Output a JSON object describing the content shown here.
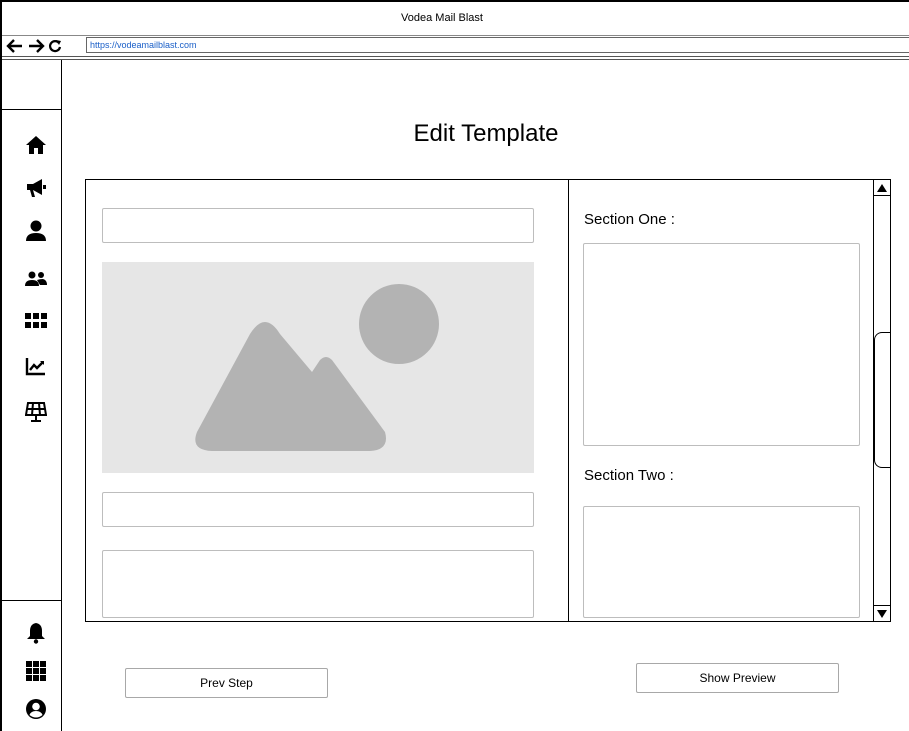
{
  "window": {
    "title": "Vodea Mail Blast",
    "url": "https://vodeamailblast.com"
  },
  "sidebar": {
    "top_items": [
      {
        "icon": "home-icon"
      },
      {
        "icon": "megaphone-icon"
      },
      {
        "icon": "user-icon"
      },
      {
        "icon": "users-icon"
      },
      {
        "icon": "grid-icon"
      },
      {
        "icon": "chart-line-icon"
      },
      {
        "icon": "solar-panel-icon"
      }
    ],
    "bottom_items": [
      {
        "icon": "bell-icon"
      },
      {
        "icon": "apps-grid-icon"
      },
      {
        "icon": "user-circle-icon"
      }
    ]
  },
  "main": {
    "page_title": "Edit Template",
    "sections": {
      "one_label": "Section One :",
      "two_label": "Section Two :"
    },
    "buttons": {
      "prev_step": "Prev Step",
      "show_preview": "Show Preview"
    }
  },
  "colors": {
    "url": "#1a5fc8",
    "placeholder_bg": "#e6e6e6",
    "placeholder_shape": "#b3b3b3"
  }
}
